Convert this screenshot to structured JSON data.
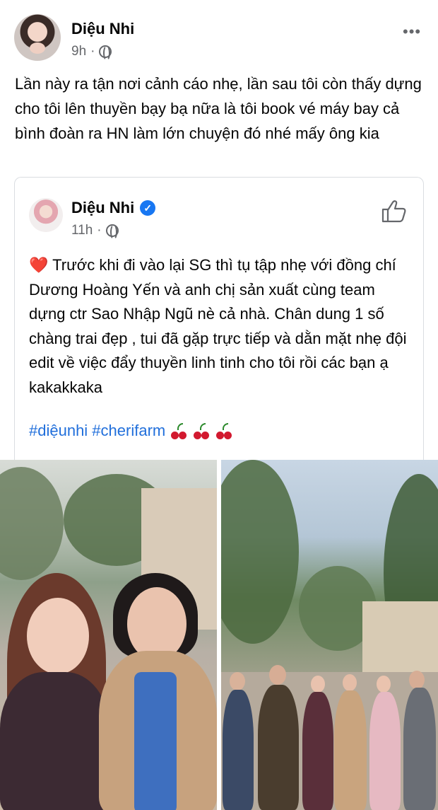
{
  "post": {
    "author": "Diệu Nhi",
    "time": "9h",
    "separator": "·",
    "more": "•••",
    "text": "Lần này ra tận nơi cảnh cáo nhẹ, lần sau tôi còn thấy dựng cho tôi lên thuyền bạy bạ nữa là tôi book vé máy bay cả bình đoàn ra HN làm lớn chuyện đó nhé mấy ông kia"
  },
  "shared": {
    "author": "Diệu Nhi",
    "verified_mark": "✓",
    "time": "11h",
    "separator": "·",
    "heart": "❤️",
    "text": "Trước khi đi vào lại SG thì tụ tập nhẹ với đồng chí Dương Hoàng Yến và anh chị sản xuất cùng team dựng ctr Sao Nhập Ngũ nè cả nhà. Chân dung 1 số chàng trai đẹp , tui đã gặp trực tiếp và dằn mặt nhẹ đội edit về việc đẩy thuyền linh tinh cho tôi rồi các bạn ạ kakakkaka",
    "hashtags": "#diệunhi #cherifarm",
    "icons": [
      "cherry-icon",
      "cherry-icon",
      "cherry-icon"
    ]
  },
  "colors": {
    "link": "#216fdb",
    "meta": "#65676b",
    "verified": "#1877f2"
  }
}
